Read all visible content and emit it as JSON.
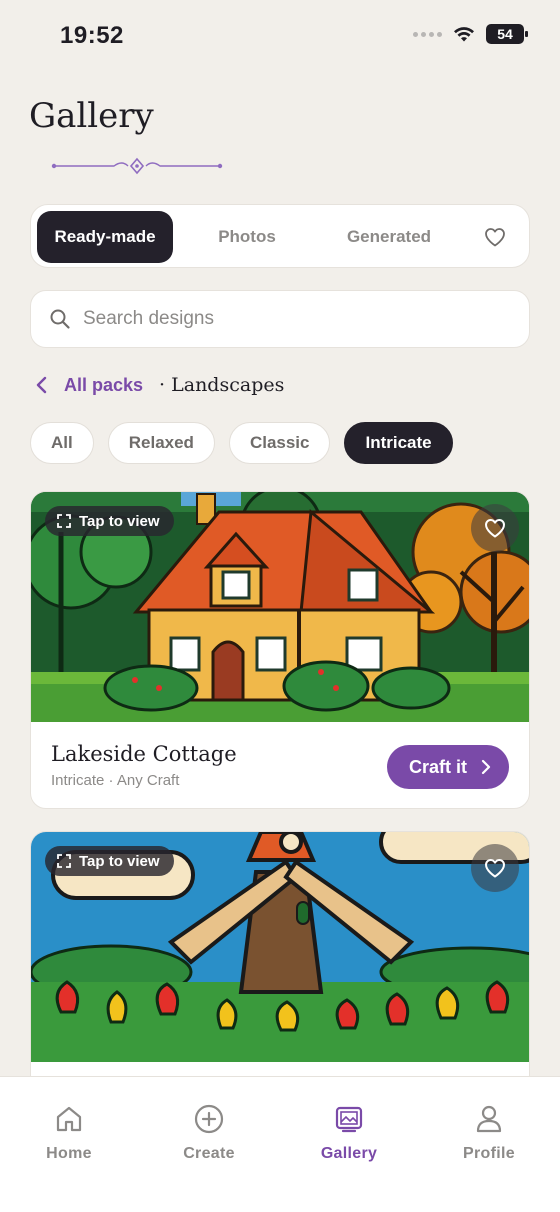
{
  "status_bar": {
    "time": "19:52",
    "battery": "54"
  },
  "header": {
    "title": "Gallery"
  },
  "segments": {
    "items": [
      "Ready-made",
      "Photos",
      "Generated"
    ],
    "active": "Ready-made"
  },
  "search": {
    "placeholder": "Search designs",
    "value": ""
  },
  "breadcrumb": {
    "link": "All packs",
    "current": "· Landscapes"
  },
  "chips": {
    "items": [
      "All",
      "Relaxed",
      "Classic",
      "Intricate"
    ],
    "active": "Intricate"
  },
  "cards": [
    {
      "title": "Lakeside Cottage",
      "meta": "Intricate · Any Craft",
      "tap_label": "Tap to view",
      "cta": "Craft it"
    },
    {
      "title": "",
      "meta": "",
      "tap_label": "Tap to view",
      "cta": ""
    }
  ],
  "tabbar": {
    "items": [
      "Home",
      "Create",
      "Gallery",
      "Profile"
    ],
    "active": "Gallery"
  },
  "colors": {
    "accent": "#7a4aa8",
    "dark": "#24212b",
    "background": "#f2efea"
  },
  "icons": [
    "wifi-icon",
    "heart-icon",
    "search-icon",
    "chevron-left-icon",
    "expand-icon",
    "chevron-right-icon",
    "home-icon",
    "plus-circle-icon",
    "gallery-icon",
    "profile-icon"
  ]
}
